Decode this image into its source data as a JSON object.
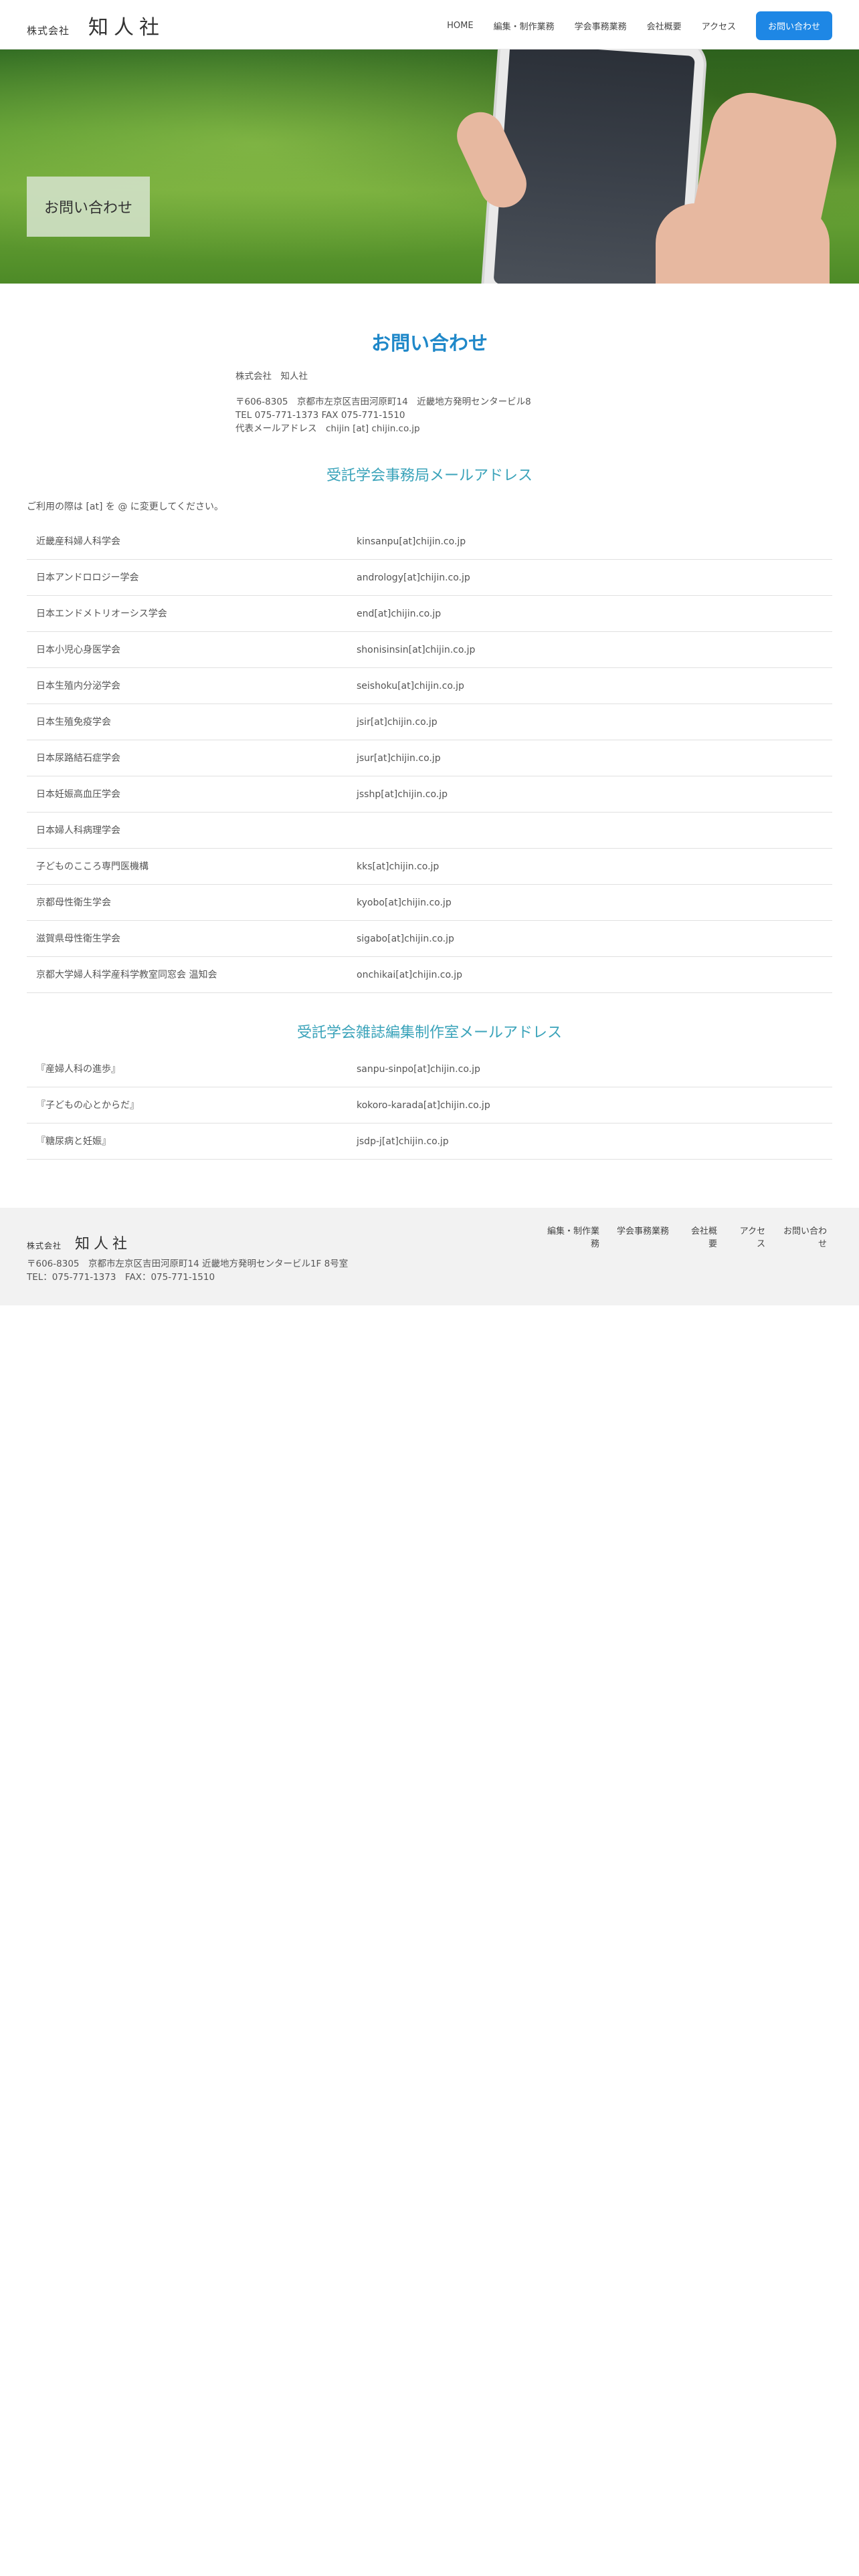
{
  "header": {
    "logo_small": "株式会社",
    "logo_big": "知人社",
    "nav": [
      "HOME",
      "編集・制作業務",
      "学会事務業務",
      "会社概要",
      "アクセス"
    ],
    "cta": "お問い合わせ"
  },
  "hero": {
    "title": "お問い合わせ"
  },
  "main": {
    "title": "お問い合わせ",
    "company_name": "株式会社　知人社",
    "address": "〒606-8305　京都市左京区吉田河原町14　近畿地方発明センタービル8",
    "tel_fax": "TEL 075-771-1373 FAX 075-771-1510",
    "rep_email": "代表メールアドレス　chijin [at] chijin.co.jp"
  },
  "societies": {
    "title": "受託学会事務局メールアドレス",
    "note": "ご利用の際は [at] を @ に変更してください。",
    "rows": [
      {
        "name": "近畿産科婦人科学会",
        "email": "kinsanpu[at]chijin.co.jp"
      },
      {
        "name": "日本アンドロロジー学会",
        "email": "andrology[at]chijin.co.jp"
      },
      {
        "name": "日本エンドメトリオーシス学会",
        "email": "end[at]chijin.co.jp"
      },
      {
        "name": "日本小児心身医学会",
        "email": "shonisinsin[at]chijin.co.jp"
      },
      {
        "name": "日本生殖内分泌学会",
        "email": "seishoku[at]chijin.co.jp"
      },
      {
        "name": "日本生殖免疫学会",
        "email": "jsir[at]chijin.co.jp"
      },
      {
        "name": "日本尿路結石症学会",
        "email": "jsur[at]chijin.co.jp"
      },
      {
        "name": "日本妊娠高血圧学会",
        "email": "jsshp[at]chijin.co.jp"
      },
      {
        "name": "日本婦人科病理学会",
        "email": ""
      },
      {
        "name": "子どものこころ専門医機構",
        "email": "kks[at]chijin.co.jp"
      },
      {
        "name": "京都母性衛生学会",
        "email": "kyobo[at]chijin.co.jp"
      },
      {
        "name": "滋賀県母性衛生学会",
        "email": "sigabo[at]chijin.co.jp"
      },
      {
        "name": "京都大学婦人科学産科学教室同窓会 温知会",
        "email": "onchikai[at]chijin.co.jp"
      }
    ]
  },
  "journals": {
    "title": "受託学会雑誌編集制作室メールアドレス",
    "rows": [
      {
        "name": "『産婦人科の進歩』",
        "email": "sanpu-sinpo[at]chijin.co.jp"
      },
      {
        "name": "『子どもの心とからだ』",
        "email": "kokoro-karada[at]chijin.co.jp"
      },
      {
        "name": "『糖尿病と妊娠』",
        "email": "jsdp-j[at]chijin.co.jp"
      }
    ]
  },
  "footer": {
    "logo_small": "株式会社",
    "logo_big": "知人社",
    "address": "〒606-8305　京都市左京区吉田河原町14 近畿地方発明センタービル1F 8号室",
    "tel_fax": "TEL：075-771-1373　FAX：075-771-1510",
    "nav": [
      "編集・制作業務",
      "学会事務業務",
      "会社概要",
      "アクセス",
      "お問い合わせ"
    ]
  }
}
